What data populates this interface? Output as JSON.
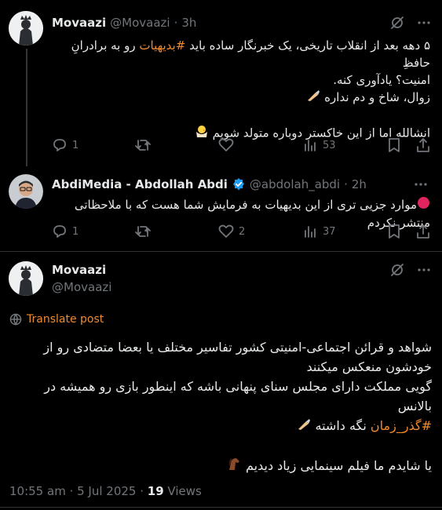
{
  "tweet1": {
    "name": "Movaazi",
    "handle": "@Movaazi",
    "separator": "·",
    "time": "3h",
    "line1a": "۵ دهه بعد از انقلاب تاریخی، یک خبرنگار ساده باید ",
    "hashtag": "#بدیهیات",
    "line1b": " رو به برادرانِ حافظِ",
    "line2": "امنیت؟ یادآوری کنه.",
    "line3": "زوال، شاخ و دم نداره",
    "line4": "انشالله اما از این خاکستر دوباره متولد شویم",
    "stats": {
      "replies": "1",
      "reposts": "",
      "likes": "",
      "views": "53"
    }
  },
  "tweet2": {
    "name": "AbdiMedia - Abdollah Abdi",
    "handle": "@abdolah_abdi",
    "separator": "·",
    "time": "2h",
    "body": "موارد جزیی تری از این بدیهیات به فرمایش شما هست که با ملاحظاتی منتشر نکردم",
    "stats": {
      "replies": "1",
      "reposts": "",
      "likes": "2",
      "views": "37"
    }
  },
  "main": {
    "name": "Movaazi",
    "handle": "@Movaazi",
    "translate_label": "Translate post",
    "p1": "شواهد و قرائن اجتماعی-امنیتی کشور تفاسیر مختلف یا بعضا متضادی رو از خودشون منعکس میکنند",
    "p2": "گویی مملکت دارای مجلس سنای پنهانی باشه که اینطور بازی رو همیشه در بالانس",
    "p2_tag": "#گذر_زمان",
    "p2_tail": " نگه داشته",
    "p3": "یا شایدم ما فیلم سینمایی زیاد دیدیم",
    "timestamp": "10:55 am · 5 Jul 2025 · ",
    "views_count": "19",
    "views_label": " Views"
  },
  "colors": {
    "accent": "#f08a2e",
    "verified": "#1d9bf0",
    "muted": "#71767b",
    "red_dot": "#e0245e"
  }
}
